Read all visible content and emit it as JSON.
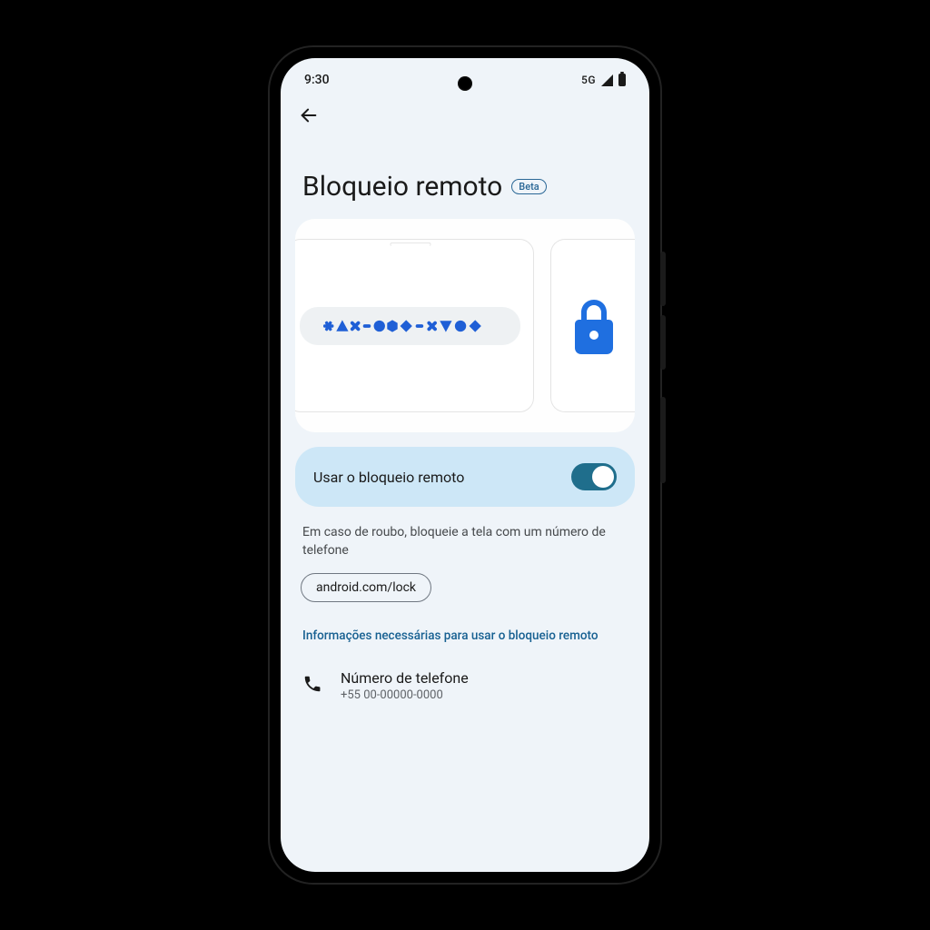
{
  "status": {
    "time": "9:30",
    "network_label": "5G"
  },
  "page": {
    "title": "Bloqueio remoto",
    "badge": "Beta"
  },
  "toggle": {
    "label": "Usar o bloqueio remoto",
    "on": true
  },
  "description": "Em caso de roubo, bloqueie a tela com um número de telefone",
  "url_chip": "android.com/lock",
  "info_link": "Informações necessárias para usar o bloqueio remoto",
  "phone": {
    "label": "Número de telefone",
    "value": "+55 00-00000-0000"
  }
}
